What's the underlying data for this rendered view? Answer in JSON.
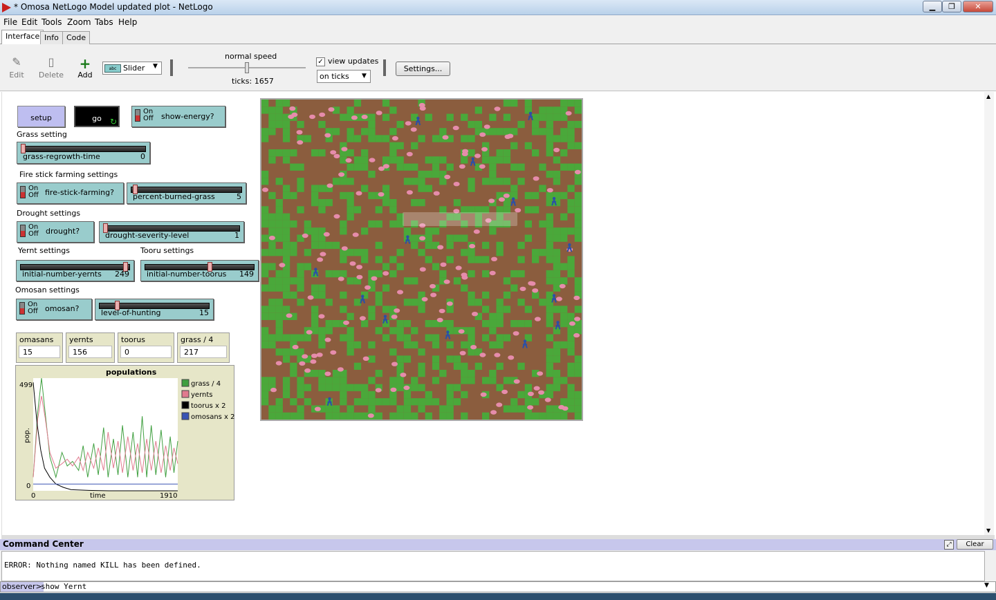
{
  "window": {
    "title": "* Omosa NetLogo Model updated plot - NetLogo",
    "min": "▁",
    "max": "❐",
    "close": "✕"
  },
  "menu": [
    "File",
    "Edit",
    "Tools",
    "Zoom",
    "Tabs",
    "Help"
  ],
  "tabs": [
    "Interface",
    "Info",
    "Code"
  ],
  "toolbar": {
    "edit": "Edit",
    "delete": "Delete",
    "add": "Add",
    "widget_type": "Slider",
    "speed_label": "normal speed",
    "ticks_label": "ticks: 1657",
    "speed_level": 0.5,
    "view_updates_label": "view updates",
    "view_updates_checked": true,
    "update_mode": "on ticks",
    "settings": "Settings..."
  },
  "widgets": {
    "setup": "setup",
    "go": "go",
    "show_energy": {
      "label": "show-energy?",
      "on": "On",
      "off": "Off"
    },
    "notes": {
      "grass": "Grass setting",
      "fire": "Fire stick farming settings",
      "drought": "Drought settings",
      "yernt": "Yernt settings",
      "tooru": "Tooru settings",
      "omosan": "Omosan settings"
    },
    "sliders": {
      "grass_regrowth": {
        "label": "grass-regrowth-time",
        "value": "0",
        "fraction": 0.0
      },
      "percent_burned": {
        "label": "percent-burned-grass",
        "value": "5",
        "fraction": 0.02
      },
      "drought_severity": {
        "label": "drought-severity-level",
        "value": "1",
        "fraction": 0.0
      },
      "init_yernts": {
        "label": "initial-number-yernts",
        "value": "249",
        "fraction": 0.98
      },
      "init_toorus": {
        "label": "initial-number-toorus",
        "value": "149",
        "fraction": 0.6
      },
      "hunting": {
        "label": "level-of-hunting",
        "value": "15",
        "fraction": 0.15
      }
    },
    "switches": {
      "fire_stick": {
        "label": "fire-stick-farming?",
        "on": "On",
        "off": "Off"
      },
      "drought": {
        "label": "drought?",
        "on": "On",
        "off": "Off"
      },
      "omosan": {
        "label": "omosan?",
        "on": "On",
        "off": "Off"
      }
    },
    "monitors": [
      {
        "label": "omasans",
        "value": "15"
      },
      {
        "label": "yernts",
        "value": "156"
      },
      {
        "label": "toorus",
        "value": "0"
      },
      {
        "label": "grass / 4",
        "value": "217"
      }
    ]
  },
  "chart_data": {
    "type": "line",
    "title": "populations",
    "xlabel": "time",
    "ylabel": "pop.",
    "xlim": [
      0,
      1910
    ],
    "ylim": [
      0,
      499
    ],
    "x_ticks": [
      "0",
      "1910"
    ],
    "y_ticks": [
      "0",
      "499"
    ],
    "legend_position": "right",
    "series": [
      {
        "name": "grass / 4",
        "color": "#3f9f3f",
        "points": [
          [
            0,
            60
          ],
          [
            60,
            350
          ],
          [
            110,
            499
          ],
          [
            160,
            340
          ],
          [
            220,
            150
          ],
          [
            300,
            60
          ],
          [
            380,
            170
          ],
          [
            450,
            110
          ],
          [
            520,
            130
          ],
          [
            600,
            90
          ],
          [
            660,
            200
          ],
          [
            720,
            60
          ],
          [
            800,
            210
          ],
          [
            860,
            70
          ],
          [
            930,
            280
          ],
          [
            990,
            60
          ],
          [
            1060,
            230
          ],
          [
            1120,
            70
          ],
          [
            1180,
            290
          ],
          [
            1250,
            60
          ],
          [
            1320,
            260
          ],
          [
            1380,
            60
          ],
          [
            1440,
            330
          ],
          [
            1500,
            60
          ],
          [
            1560,
            290
          ],
          [
            1620,
            70
          ],
          [
            1690,
            270
          ],
          [
            1750,
            60
          ],
          [
            1810,
            240
          ],
          [
            1860,
            80
          ],
          [
            1910,
            220
          ]
        ]
      },
      {
        "name": "yernts",
        "color": "#e07a8e",
        "points": [
          [
            0,
            60
          ],
          [
            60,
            320
          ],
          [
            110,
            420
          ],
          [
            160,
            320
          ],
          [
            220,
            170
          ],
          [
            300,
            100
          ],
          [
            380,
            120
          ],
          [
            450,
            140
          ],
          [
            520,
            110
          ],
          [
            600,
            150
          ],
          [
            660,
            90
          ],
          [
            720,
            170
          ],
          [
            800,
            100
          ],
          [
            860,
            190
          ],
          [
            930,
            90
          ],
          [
            990,
            260
          ],
          [
            1060,
            100
          ],
          [
            1120,
            220
          ],
          [
            1180,
            80
          ],
          [
            1250,
            240
          ],
          [
            1320,
            90
          ],
          [
            1380,
            210
          ],
          [
            1440,
            80
          ],
          [
            1500,
            230
          ],
          [
            1560,
            90
          ],
          [
            1620,
            220
          ],
          [
            1690,
            80
          ],
          [
            1750,
            200
          ],
          [
            1810,
            90
          ],
          [
            1860,
            190
          ],
          [
            1910,
            120
          ]
        ]
      },
      {
        "name": "toorus x 2",
        "color": "#000000",
        "points": [
          [
            0,
            480
          ],
          [
            50,
            300
          ],
          [
            100,
            180
          ],
          [
            150,
            100
          ],
          [
            220,
            60
          ],
          [
            300,
            30
          ],
          [
            400,
            15
          ],
          [
            500,
            5
          ],
          [
            700,
            2
          ],
          [
            1000,
            0
          ],
          [
            1910,
            0
          ]
        ]
      },
      {
        "name": "omosans x 2",
        "color": "#3a55b4",
        "points": [
          [
            0,
            30
          ],
          [
            300,
            30
          ],
          [
            600,
            30
          ],
          [
            900,
            30
          ],
          [
            1200,
            30
          ],
          [
            1500,
            30
          ],
          [
            1910,
            30
          ]
        ]
      }
    ]
  },
  "world": {
    "size": "45x45 patches",
    "grass_color": "#4aa83a",
    "dirt_color": "#8b5d3e",
    "sheep_color": "#e68cab",
    "human_color": "#2b50a6",
    "yernts_shown": 156,
    "omosans_shown": 15
  },
  "command_center": {
    "title": "Command Center",
    "clear": "Clear",
    "output": "ERROR: Nothing named KILL has been defined.",
    "prompt": "observer>",
    "input": "show Yernt"
  }
}
